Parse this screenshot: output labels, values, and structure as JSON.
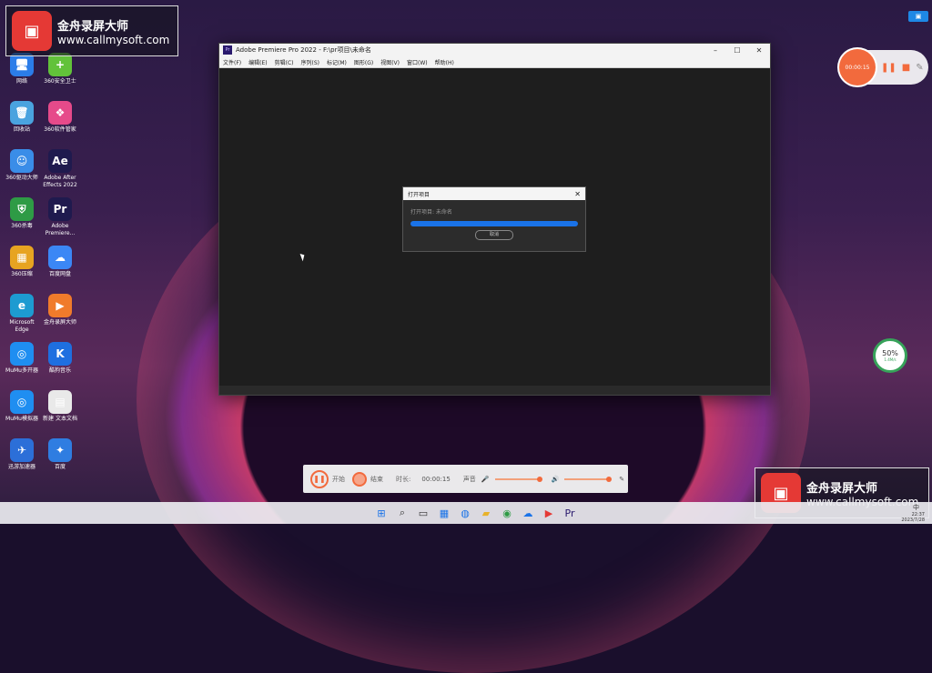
{
  "watermark": {
    "app": "金舟录屏大师",
    "url": "www.callmysoft.com"
  },
  "desktop": {
    "icons": [
      {
        "label": "网络",
        "color": "#2b7de9",
        "glyph": "🖥"
      },
      {
        "label": "360安全卫士",
        "color": "#62c23a",
        "glyph": "+"
      },
      {
        "label": "回收站",
        "color": "#4aa3df",
        "glyph": "🗑"
      },
      {
        "label": "360软件管家",
        "color": "#e64a8a",
        "glyph": "❖"
      },
      {
        "label": "360驱动大师",
        "color": "#3a8de8",
        "glyph": "☺"
      },
      {
        "label": "Adobe After Effects 2022",
        "color": "#1f1a4e",
        "glyph": "Ae"
      },
      {
        "label": "360杀毒",
        "color": "#2e9b45",
        "glyph": "⛨"
      },
      {
        "label": "Adobe Premiere...",
        "color": "#1f1a4e",
        "glyph": "Pr"
      },
      {
        "label": "360压缩",
        "color": "#e7a421",
        "glyph": "▦"
      },
      {
        "label": "百度网盘",
        "color": "#3b87f5",
        "glyph": "☁"
      },
      {
        "label": "Microsoft Edge",
        "color": "#1d9bd1",
        "glyph": "e"
      },
      {
        "label": "金舟录屏大师",
        "color": "#f07b2b",
        "glyph": "▶"
      },
      {
        "label": "MuMu多开器",
        "color": "#1f8ef1",
        "glyph": "◎"
      },
      {
        "label": "酷狗音乐",
        "color": "#1e6fe0",
        "glyph": "K"
      },
      {
        "label": "MuMu模拟器",
        "color": "#1f8ef1",
        "glyph": "◎"
      },
      {
        "label": "新建 文本文档",
        "color": "#e9e9e9",
        "glyph": "▤"
      },
      {
        "label": "迅游加速器",
        "color": "#2c6fd8",
        "glyph": "✈"
      },
      {
        "label": "百度",
        "color": "#2f7de1",
        "glyph": "✦"
      }
    ]
  },
  "premiere": {
    "title": "Adobe Premiere Pro 2022 - F:\\pr项目\\未命名",
    "menu": [
      "文件(F)",
      "编辑(E)",
      "剪辑(C)",
      "序列(S)",
      "标记(M)",
      "图形(G)",
      "视图(V)",
      "窗口(W)",
      "帮助(H)"
    ],
    "controls": {
      "min": "–",
      "max": "☐",
      "close": "✕"
    }
  },
  "dialog": {
    "title": "打开项目",
    "message": "打开项目: 未命名",
    "progress": 1.0,
    "cancel": "取消"
  },
  "recorder_float": {
    "time": "00:00:15"
  },
  "recorder_bar": {
    "start_label": "开始",
    "stop_label": "结束",
    "duration_label": "时长:",
    "duration": "00:00:15",
    "sound_label": "声音"
  },
  "netmon": {
    "percent": "50%",
    "label": "1.4M/s"
  },
  "tray": {
    "ime": "中",
    "time": "22:37",
    "date": "2023/7/28"
  },
  "colors": {
    "accent": "#f26a3d",
    "progress": "#1a73e8"
  }
}
